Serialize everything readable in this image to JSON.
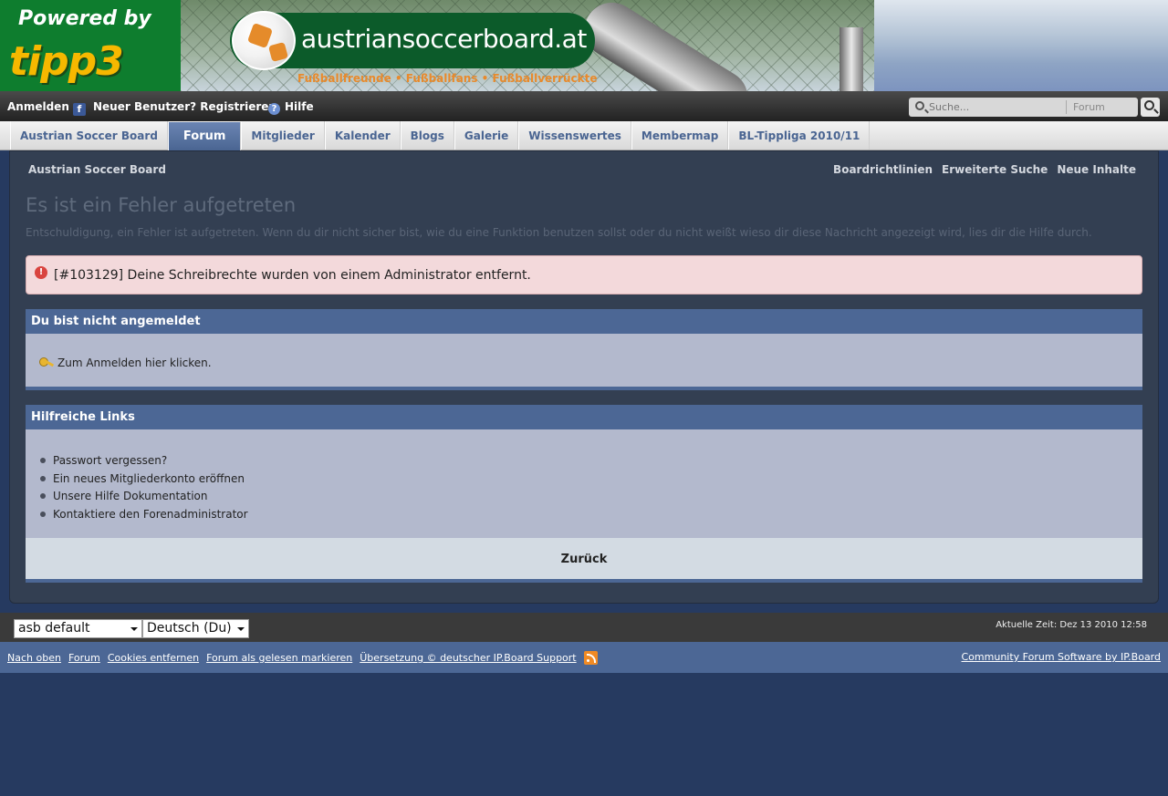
{
  "banner": {
    "powered_by": "Powered by",
    "tipp3_logo": "tipp3",
    "site_title": "austriansoccerboard.at",
    "tagline": "Fußballfreunde • Fußballfans • Fußballverrückte"
  },
  "userbar": {
    "login": "Anmelden",
    "register": "Neuer Benutzer? Registrieren",
    "help": "Hilfe",
    "search_placeholder": "Suche...",
    "search_scope": "Forum"
  },
  "nav": {
    "tabs": [
      {
        "label": "Austrian Soccer Board"
      },
      {
        "label": "Forum",
        "active": true
      },
      {
        "label": "Mitglieder"
      },
      {
        "label": "Kalender"
      },
      {
        "label": "Blogs"
      },
      {
        "label": "Galerie"
      },
      {
        "label": "Wissenswertes"
      },
      {
        "label": "Membermap"
      },
      {
        "label": "BL-Tippliga 2010/11"
      }
    ]
  },
  "content": {
    "breadcrumb": "Austrian Soccer Board",
    "top_links": [
      "Boardrichtlinien",
      "Erweiterte Suche",
      "Neue Inhalte"
    ],
    "error_title": "Es ist ein Fehler aufgetreten",
    "error_description": "Entschuldigung, ein Fehler ist aufgetreten. Wenn du dir nicht sicher bist, wie du eine Funktion benutzen sollst oder du nicht weißt wieso dir diese Nachricht angezeigt wird, lies dir die Hilfe durch.",
    "error_message": "[#103129] Deine Schreibrechte wurden von einem Administrator entfernt.",
    "not_logged_in": {
      "header": "Du bist nicht angemeldet",
      "link": "Zum Anmelden hier klicken."
    },
    "helpful_links": {
      "header": "Hilfreiche Links",
      "items": [
        "Passwort vergessen?",
        "Ein neues Mitgliederkonto eröffnen",
        "Unsere Hilfe Dokumentation",
        "Kontaktiere den Forenadministrator"
      ],
      "back": "Zurück"
    }
  },
  "footer": {
    "skin": "asb default",
    "language": "Deutsch (Du)",
    "time": "Aktuelle Zeit: Dez 13 2010 12:58",
    "links": [
      "Nach oben",
      "Forum",
      "Cookies entfernen",
      "Forum als gelesen markieren",
      "Übersetzung © deutscher IP.Board Support"
    ],
    "credit": "Community Forum Software by IP.Board"
  },
  "colors": {
    "page_bg": "#263a60",
    "content_bg": "#333f52",
    "block_header": "#4c6795",
    "block_body": "#b3b9cd",
    "error_bg": "#f3d9db",
    "nav_active": "#4a6592",
    "tipp3_green": "#0e7d2e",
    "tipp3_yellow": "#f6b800"
  }
}
